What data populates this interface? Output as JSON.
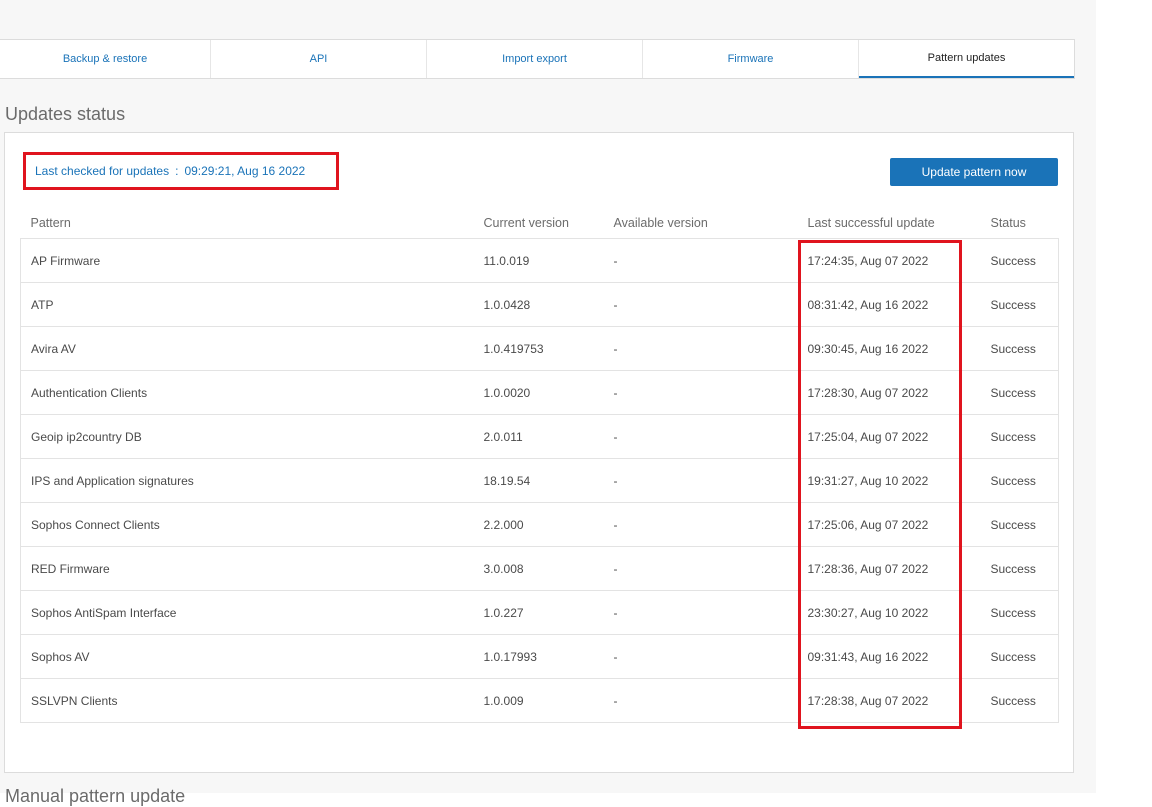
{
  "tabs": [
    {
      "label": "Backup & restore",
      "active": false
    },
    {
      "label": "API",
      "active": false
    },
    {
      "label": "Import export",
      "active": false
    },
    {
      "label": "Firmware",
      "active": false
    },
    {
      "label": "Pattern updates",
      "active": true
    }
  ],
  "section": {
    "title": "Updates status",
    "next_title": "Manual pattern update"
  },
  "last_checked": {
    "label": "Last checked for updates",
    "separator": ":",
    "value": "09:29:21, Aug 16 2022"
  },
  "update_button": {
    "label": "Update pattern now"
  },
  "table": {
    "headers": [
      "Pattern",
      "Current version",
      "Available version",
      "Last successful update",
      "Status"
    ],
    "rows": [
      [
        "AP Firmware",
        "11.0.019",
        "-",
        "17:24:35, Aug 07 2022",
        "Success"
      ],
      [
        "ATP",
        "1.0.0428",
        "-",
        "08:31:42, Aug 16 2022",
        "Success"
      ],
      [
        "Avira AV",
        "1.0.419753",
        "-",
        "09:30:45, Aug 16 2022",
        "Success"
      ],
      [
        "Authentication Clients",
        "1.0.0020",
        "-",
        "17:28:30, Aug 07 2022",
        "Success"
      ],
      [
        "Geoip ip2country DB",
        "2.0.011",
        "-",
        "17:25:04, Aug 07 2022",
        "Success"
      ],
      [
        "IPS and Application signatures",
        "18.19.54",
        "-",
        "19:31:27, Aug 10 2022",
        "Success"
      ],
      [
        "Sophos Connect Clients",
        "2.2.000",
        "-",
        "17:25:06, Aug 07 2022",
        "Success"
      ],
      [
        "RED Firmware",
        "3.0.008",
        "-",
        "17:28:36, Aug 07 2022",
        "Success"
      ],
      [
        "Sophos AntiSpam Interface",
        "1.0.227",
        "-",
        "23:30:27, Aug 10 2022",
        "Success"
      ],
      [
        "Sophos AV",
        "1.0.17993",
        "-",
        "09:31:43, Aug 16 2022",
        "Success"
      ],
      [
        "SSLVPN Clients",
        "1.0.009",
        "-",
        "17:28:38, Aug 07 2022",
        "Success"
      ]
    ]
  },
  "colors": {
    "accent": "#1a73b8",
    "highlight": "#e0141e"
  }
}
